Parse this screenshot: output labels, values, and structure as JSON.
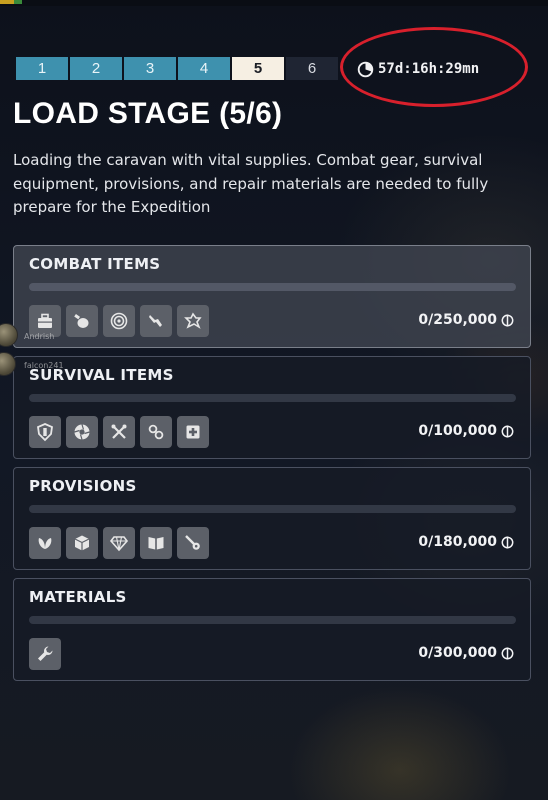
{
  "stages": [
    {
      "label": "1",
      "state": "done"
    },
    {
      "label": "2",
      "state": "done"
    },
    {
      "label": "3",
      "state": "done"
    },
    {
      "label": "4",
      "state": "done"
    },
    {
      "label": "5",
      "state": "current"
    },
    {
      "label": "6",
      "state": "locked"
    }
  ],
  "timer": {
    "icon": "clock-icon",
    "value": "57d:16h:29mn"
  },
  "title": "LOAD STAGE (5/6)",
  "description": "Loading the caravan with vital supplies. Combat gear, survival equipment, provisions, and repair materials are needed to fully prepare for the Expedition",
  "categories": [
    {
      "name": "COMBAT ITEMS",
      "amount": "0/250,000",
      "progress": 0,
      "icons": [
        "toolbox-icon",
        "grenade-icon",
        "target-icon",
        "rifle-icon",
        "gear-arrows-icon"
      ]
    },
    {
      "name": "SURVIVAL ITEMS",
      "amount": "0/100,000",
      "progress": 0,
      "icons": [
        "shield-icon",
        "aperture-icon",
        "crossed-tools-icon",
        "chain-icon",
        "medkit-icon"
      ]
    },
    {
      "name": "PROVISIONS",
      "amount": "0/180,000",
      "progress": 0,
      "icons": [
        "leaf-icon",
        "box-icon",
        "gem-icon",
        "book-icon",
        "key-icon"
      ]
    },
    {
      "name": "MATERIALS",
      "amount": "0/300,000",
      "progress": 0,
      "icons": [
        "wrench-icon"
      ]
    }
  ],
  "currency_icon": "coin-icon",
  "players": [
    {
      "name": "Andrish"
    },
    {
      "name": "falcon241"
    }
  ],
  "colors": {
    "accent": "#3e91ae",
    "current_stage": "#f6efe3",
    "highlight_ring": "#d8202c"
  }
}
